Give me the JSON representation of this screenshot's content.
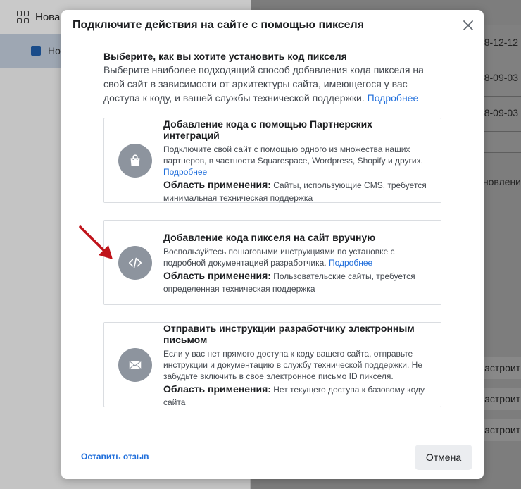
{
  "background": {
    "top_item": "Новая",
    "selected_item": "Но",
    "dates": [
      "8-12-12",
      "8-09-03",
      "8-09-03"
    ],
    "update_label": "новлени",
    "setup_buttons": [
      "Настроит",
      "Настроит",
      "Настроит"
    ]
  },
  "modal": {
    "title": "Подключите действия на сайте с помощью пикселя",
    "intro_heading": "Выберите, как вы хотите установить код пикселя",
    "intro_text": "Выберите наиболее подходящий способ добавления кода пикселя на свой сайт в зависимости от архитектуры сайта, имеющегося у вас доступа к коду, и вашей службы технической поддержки.",
    "intro_link": "Подробнее",
    "scope_label": "Область применения:",
    "options": [
      {
        "title": "Добавление кода с помощью Партнерских интеграций",
        "description": "Подключите свой сайт с помощью одного из множества наших партнеров, в частности Squarespace, Wordpress, Shopify и других.",
        "link": "Подробнее",
        "scope": "Сайты, использующие CMS, требуется минимальная техническая поддержка",
        "icon": "shopping-bag-icon"
      },
      {
        "title": "Добавление кода пикселя на сайт вручную",
        "description": "Воспользуйтесь пошаговыми инструкциями по установке с подробной документацией разработчика.",
        "link": "Подробнее",
        "scope": "Пользовательские сайты, требуется определенная техническая поддержка",
        "icon": "code-icon"
      },
      {
        "title": "Отправить инструкции разработчику электронным письмом",
        "description": "Если у вас нет прямого доступа к коду вашего сайта, отправьте инструкции и документацию в службу технической поддержки. Не забудьте включить в свое электронное письмо ID пикселя.",
        "link": "",
        "scope": "Нет текущего доступа к базовому коду сайта",
        "icon": "envelope-icon"
      }
    ],
    "feedback_link": "Оставить отзыв",
    "cancel_label": "Отмена"
  },
  "colors": {
    "link": "#216fdb",
    "icon_circle": "#8d949e",
    "annotation_arrow": "#c0141b"
  }
}
